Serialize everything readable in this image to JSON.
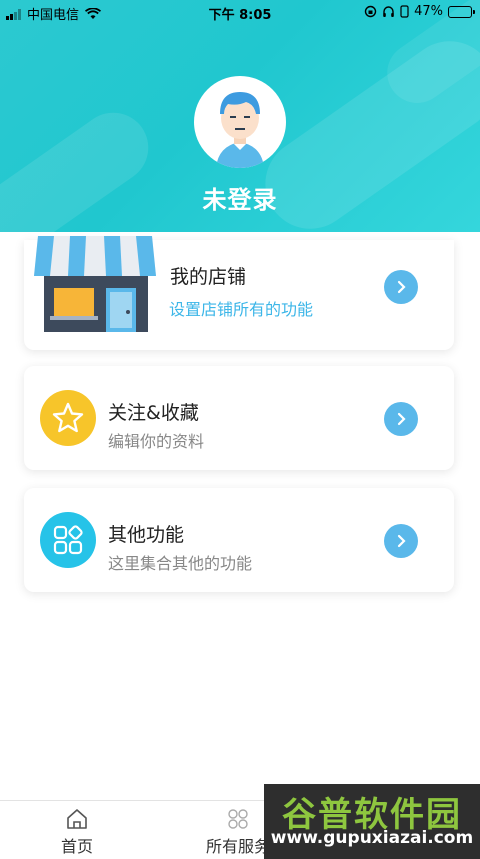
{
  "status_bar": {
    "carrier": "中国电信",
    "time": "下午 8:05",
    "battery": "47%",
    "battery_level": 0.47
  },
  "profile": {
    "name": "未登录"
  },
  "menu": [
    {
      "title": "我的店铺",
      "subtitle": "设置店铺所有的功能",
      "icon": "store-icon"
    },
    {
      "title": "关注&收藏",
      "subtitle": "编辑你的资料",
      "icon": "star-icon"
    },
    {
      "title": "其他功能",
      "subtitle": "这里集合其他的功能",
      "icon": "apps-grid-icon"
    }
  ],
  "tabbar": {
    "home": "首页",
    "services": "所有服务"
  },
  "watermark": {
    "text": "谷普软件园",
    "url": "www.gupuxiazai.com"
  },
  "colors": {
    "header": "#20c7cf",
    "accent": "#5ab8ea",
    "subtitle_highlight": "#3cb6e8",
    "star_circle": "#f7c52a",
    "apps_circle": "#26c3e8"
  }
}
